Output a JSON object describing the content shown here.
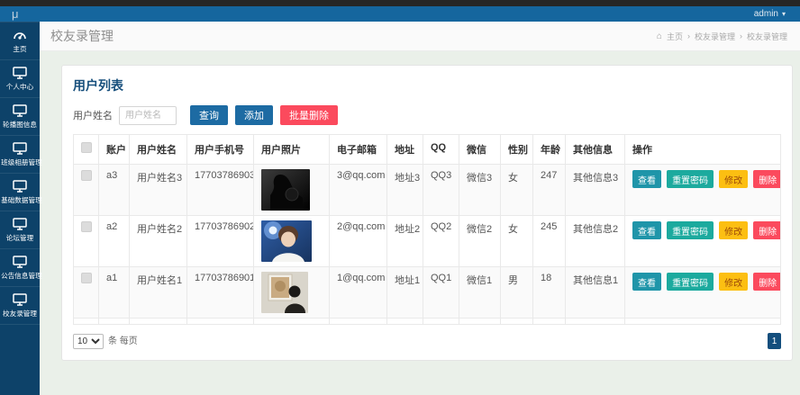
{
  "topbar": {
    "logo": "μ",
    "user": "admin",
    "caret": "▾"
  },
  "sidebar": {
    "items": [
      {
        "id": "home",
        "label": "主页",
        "icon": "dashboard-icon"
      },
      {
        "id": "profile",
        "label": "个人中心",
        "icon": "monitor-icon"
      },
      {
        "id": "carousel",
        "label": "轮播图信息",
        "icon": "monitor-icon"
      },
      {
        "id": "class-album",
        "label": "班级相册管理",
        "icon": "monitor-icon"
      },
      {
        "id": "base-data",
        "label": "基础数据管理",
        "icon": "monitor-icon"
      },
      {
        "id": "forum",
        "label": "论坛管理",
        "icon": "monitor-icon"
      },
      {
        "id": "notice",
        "label": "公告信息管理",
        "icon": "monitor-icon"
      },
      {
        "id": "alumni",
        "label": "校友录管理",
        "icon": "monitor-icon"
      }
    ]
  },
  "header": {
    "title": "校友录管理",
    "breadcrumb": {
      "home_icon": "⌂",
      "home": "主页",
      "separator": "›",
      "level1": "校友录管理",
      "level2": "校友录管理"
    }
  },
  "panel": {
    "title": "用户列表",
    "search": {
      "label": "用户姓名",
      "placeholder": "用户姓名"
    },
    "toolbar": {
      "query": "查询",
      "add": "添加",
      "batch_delete": "批量删除"
    },
    "table": {
      "headers": [
        "账户",
        "用户姓名",
        "用户手机号",
        "用户照片",
        "电子邮箱",
        "地址",
        "QQ",
        "微信",
        "性别",
        "年龄",
        "其他信息",
        "操作"
      ],
      "actions": {
        "view": "查看",
        "reset_password": "重置密码",
        "edit": "修改",
        "delete": "删除"
      },
      "rows": [
        {
          "account": "a3",
          "name": "用户姓名3",
          "phone": "17703786903",
          "photo": "dark-silhouette-portrait",
          "email": "3@qq.com",
          "address": "地址3",
          "qq": "QQ3",
          "wechat": "微信3",
          "gender": "女",
          "age": "247",
          "other": "其他信息3"
        },
        {
          "account": "a2",
          "name": "用户姓名2",
          "phone": "17703786902",
          "photo": "young-man-blue-stage-portrait",
          "email": "2@qq.com",
          "address": "地址2",
          "qq": "QQ2",
          "wechat": "微信2",
          "gender": "女",
          "age": "245",
          "other": "其他信息2"
        },
        {
          "account": "a1",
          "name": "用户姓名1",
          "phone": "17703786901",
          "photo": "person-viewing-gallery-painting",
          "email": "1@qq.com",
          "address": "地址1",
          "qq": "QQ1",
          "wechat": "微信1",
          "gender": "男",
          "age": "18",
          "other": "其他信息1"
        }
      ]
    },
    "pagination": {
      "page_size": "10",
      "per_page_text": "条 每页",
      "page": "1"
    }
  },
  "colors": {
    "top_strip": "#262626",
    "appbar_blue": "#15669e",
    "sidebar_navy": "#0d4269",
    "content_bg": "#eaf0e9",
    "panel_title_navy": "#174f7c",
    "primary_btn": "#1d6ba3",
    "danger_btn": "#fb4a5d",
    "view_btn": "#1f95a9",
    "reset_btn": "#1caa9e",
    "edit_btn": "#fcbf12",
    "page_btn": "#134e7d"
  }
}
